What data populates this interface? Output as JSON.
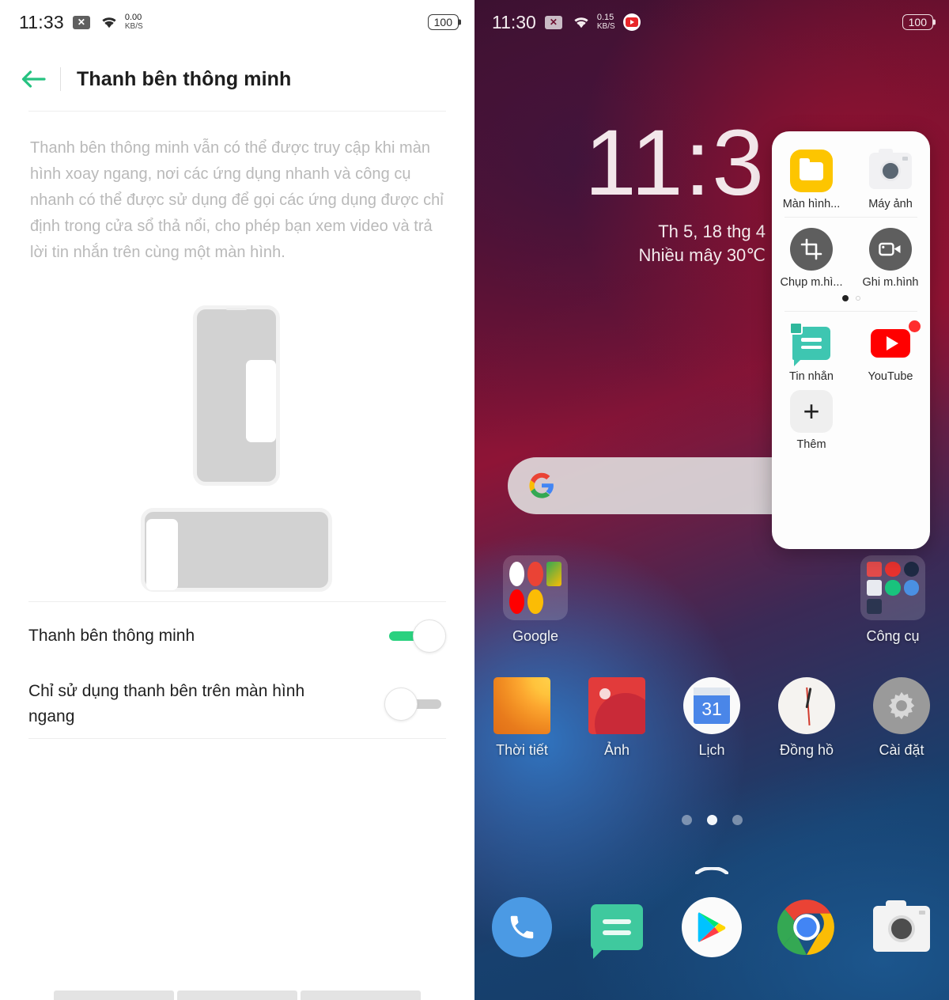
{
  "settings_screen": {
    "status_bar": {
      "time": "11:33",
      "net_speed_value": "0.00",
      "net_speed_unit": "KB/S",
      "battery": "100",
      "icons": [
        "x-square-icon",
        "wifi-icon"
      ]
    },
    "header": {
      "back_icon": "back-arrow-icon",
      "title": "Thanh bên thông minh"
    },
    "description": "Thanh bên thông minh vẫn có thể được truy cập khi màn hình xoay ngang, nơi các ứng dụng nhanh và công cụ nhanh có thể được sử dụng để gọi các ứng dụng được chỉ định trong cửa sổ thả nổi, cho phép bạn xem video và trả lời tin nhắn trên cùng một màn hình.",
    "illustration": {
      "portrait_phone": "phone-portrait-illustration",
      "landscape_phone": "phone-landscape-illustration"
    },
    "rows": [
      {
        "label": "Thanh bên thông minh",
        "state": "on"
      },
      {
        "label": "Chỉ sử dụng thanh bên trên màn hình ngang",
        "state": "off"
      }
    ],
    "colors": {
      "accent_green": "#2ad17f",
      "track_off": "#cdcdcd",
      "title": "#1d1d1d",
      "desc": "#b9b9b9"
    }
  },
  "home_screen": {
    "status_bar": {
      "time": "11:30",
      "net_speed_value": "0.15",
      "net_speed_unit": "KB/S",
      "battery": "100",
      "icons": [
        "x-square-icon",
        "wifi-icon",
        "youtube-notification-icon"
      ]
    },
    "clock_widget": {
      "time": "11:3",
      "date": "Th 5, 18 thg 4",
      "weather": "Nhiều mây 30℃"
    },
    "search_bar": {
      "icon": "google-g-icon",
      "value": "",
      "placeholder": ""
    },
    "smart_sidebar_panel": {
      "apps_row1": [
        {
          "label": "Màn hình...",
          "icon": "folder-icon"
        },
        {
          "label": "Máy ảnh",
          "icon": "camera-icon"
        }
      ],
      "tools_row": [
        {
          "label": "Chụp m.hì...",
          "icon": "screenshot-crop-icon"
        },
        {
          "label": "Ghi m.hình",
          "icon": "screen-record-icon"
        }
      ],
      "page_dots": {
        "count": 2,
        "active": 0
      },
      "apps_row2": [
        {
          "label": "Tin nhắn",
          "icon": "messages-icon",
          "badge": false
        },
        {
          "label": "YouTube",
          "icon": "youtube-icon",
          "badge": true
        }
      ],
      "add_more": {
        "label": "Thêm",
        "icon": "plus-icon"
      }
    },
    "folders": [
      {
        "label": "Google"
      },
      {
        "label": "Công cụ"
      }
    ],
    "apps": [
      {
        "label": "Thời tiết",
        "icon": "weather-icon"
      },
      {
        "label": "Ảnh",
        "icon": "photos-icon"
      },
      {
        "label": "Lịch",
        "icon": "calendar-icon",
        "day": "31"
      },
      {
        "label": "Đồng hồ",
        "icon": "clock-icon"
      },
      {
        "label": "Cài đặt",
        "icon": "gear-icon"
      }
    ],
    "page_indicator": {
      "count": 3,
      "active": 1
    },
    "gesture_bar": "home-gesture-icon",
    "dock": [
      {
        "icon": "phone-icon",
        "label": ""
      },
      {
        "icon": "messages-icon",
        "label": ""
      },
      {
        "icon": "play-store-icon",
        "label": ""
      },
      {
        "icon": "chrome-icon",
        "label": ""
      },
      {
        "icon": "camera-icon",
        "label": ""
      }
    ],
    "colors": {
      "wallpaper_red": "#8e1436",
      "wallpaper_blue": "#17406e",
      "panel_bg": "#fdfdfd"
    }
  }
}
